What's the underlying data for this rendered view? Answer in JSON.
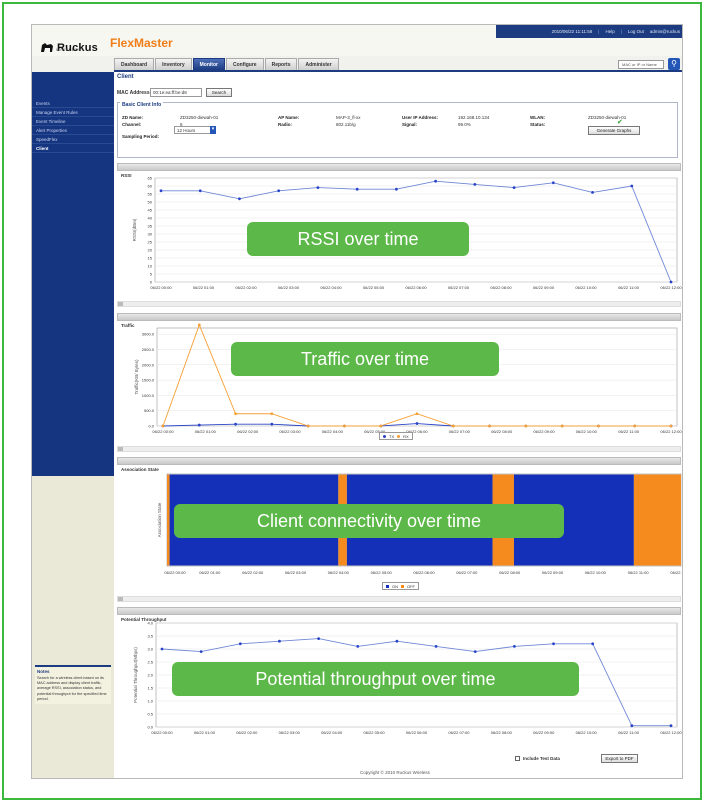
{
  "app": {
    "brand": "Ruckus",
    "brand_sub": "WIRELESS",
    "product": "FlexMaster",
    "util_datetime": "2010/06/22 11:11:58",
    "util_help": "Help",
    "util_logout": "Log Out",
    "util_user": "admin@ruckus"
  },
  "nav": {
    "tabs": [
      "Dashboard",
      "Inventory",
      "Monitor",
      "Configure",
      "Reports",
      "Administer"
    ],
    "active": "Monitor",
    "search_placeholder": "MAC or IP or Name"
  },
  "sidebar": {
    "items": [
      "Events",
      "Manage Event Rules",
      "Event Timeline",
      "Alert Properties",
      "SpeedFlex",
      "Client"
    ],
    "active": "Client",
    "notes_title": "Notes",
    "notes_text": "Search for a wireless client based on its MAC address and display client traffic, average RSSI, association status, and potential throughput for the specified time period."
  },
  "client": {
    "title": "Client",
    "mac_label": "MAC Address",
    "mac_value": "00:1e:ea:ff:be:d8",
    "search_label": "Search",
    "info_title": "Basic Client Info",
    "zd_label": "ZD Name:",
    "zd_value": "ZD3250-diewah-01",
    "channel_label": "Channel:",
    "channel_value": "6",
    "ap_label": "AP Name:",
    "ap_value": "MAP-3_fl-xx",
    "radio_label": "Radio:",
    "radio_value": "802.11b/g",
    "ip_label": "User IP Address:",
    "ip_value": "192.168.10.134",
    "signal_label": "Signal:",
    "signal_value": "99.0%",
    "wlan_label": "WLAN:",
    "wlan_value": "ZD3250-diewah-01",
    "status_label": "Status:",
    "sampling_label": "Sampling Period:",
    "sampling_value": "12 Hours",
    "generate_label": "Generate Graphs"
  },
  "sections": {
    "rssi": "RSSI",
    "traffic": "Traffic",
    "assoc": "Association State",
    "throughput": "Potential Throughput"
  },
  "callouts": {
    "rssi": "RSSI over time",
    "traffic": "Traffic over time",
    "assoc": "Client connectivity over time",
    "throughput": "Potential throughput over time"
  },
  "footer": {
    "include_label": "Include Test Data",
    "export_label": "Export to PDF",
    "copyright": "Copyright © 2010 Ruckus Wireless"
  },
  "colors": {
    "brand_blue": "#1c3b80",
    "accent_orange": "#f07d17",
    "series_blue": "#2a44c8",
    "series_orange": "#f5a035",
    "assoc_on": "#1530b8",
    "assoc_off": "#f58a1f",
    "callout_green": "#5cb848"
  },
  "chart_data": [
    {
      "type": "line",
      "ylabel": "RSSI(dBm)",
      "x": [
        "06/22 00:00",
        "06/22 01:00",
        "06/22 02:00",
        "06/22 03:00",
        "06/22 04:00",
        "06/22 05:00",
        "06/22 06:00",
        "06/22 07:00",
        "06/22 08:00",
        "06/22 09:00",
        "06/22 10:00",
        "06/22 11:00",
        "06/22 12:00"
      ],
      "y_ticks": [
        "0",
        "5",
        "10",
        "15",
        "20",
        "25",
        "30",
        "35",
        "40",
        "45",
        "50",
        "55",
        "60",
        "65"
      ],
      "ylim": [
        0,
        65
      ],
      "series": [
        {
          "name": "",
          "values": [
            57,
            57,
            52,
            57,
            59,
            58,
            58,
            63,
            61,
            59,
            62,
            56,
            60,
            0
          ]
        }
      ]
    },
    {
      "type": "line",
      "ylabel": "Traffic(KB/ Bytes)",
      "x": [
        "06/22 00:00",
        "06/22 01:00",
        "06/22 02:00",
        "06/22 03:00",
        "06/22 04:00",
        "06/22 05:00",
        "06/22 06:00",
        "06/22 07:00",
        "06/22 08:00",
        "06/22 09:00",
        "06/22 10:00",
        "06/22 11:00",
        "06/22 12:00"
      ],
      "y_ticks": [
        "0.0",
        "500.0",
        "1000.0",
        "1500.0",
        "2000.0",
        "2500.0",
        "3000.0"
      ],
      "ylim": [
        0,
        3200
      ],
      "series": [
        {
          "name": "TX",
          "values": [
            0,
            30,
            60,
            60,
            0,
            0,
            0,
            80,
            0,
            0,
            0,
            0,
            0,
            0,
            0
          ]
        },
        {
          "name": "RX",
          "values": [
            0,
            3300,
            400,
            400,
            0,
            0,
            0,
            400,
            0,
            0,
            0,
            0,
            0,
            0,
            0
          ]
        }
      ]
    },
    {
      "type": "area",
      "ylabel": "Association State",
      "x": [
        "06/22 00:00",
        "06/22 01:00",
        "06/22 02:00",
        "06/22 03:00",
        "06/22 04:00",
        "06/22 05:00",
        "06/22 06:00",
        "06/22 07:00",
        "06/22 08:00",
        "06/22 09:00",
        "06/22 10:00",
        "06/22 11:00",
        "06/22 12:00"
      ],
      "legend": [
        "ON",
        "OFF"
      ],
      "segments": [
        {
          "state": "OFF",
          "start": 0,
          "end": 0.06
        },
        {
          "state": "ON",
          "start": 0.06,
          "end": 4.0
        },
        {
          "state": "OFF",
          "start": 4.0,
          "end": 4.2
        },
        {
          "state": "ON",
          "start": 4.2,
          "end": 7.6
        },
        {
          "state": "OFF",
          "start": 7.6,
          "end": 8.1
        },
        {
          "state": "ON",
          "start": 8.1,
          "end": 10.9
        },
        {
          "state": "OFF",
          "start": 10.9,
          "end": 12.0
        }
      ]
    },
    {
      "type": "line",
      "ylabel": "Potential Throughput(Mbps)",
      "x": [
        "06/22 00:00",
        "06/22 01:00",
        "06/22 02:00",
        "06/22 03:00",
        "06/22 04:00",
        "06/22 05:00",
        "06/22 06:00",
        "06/22 07:00",
        "06/22 08:00",
        "06/22 09:00",
        "06/22 10:00",
        "06/22 11:00",
        "06/22 12:00"
      ],
      "y_ticks": [
        "0.0",
        "0.5",
        "1.0",
        "1.5",
        "2.0",
        "2.5",
        "3.0",
        "3.5",
        "4.0"
      ],
      "ylim": [
        0,
        4.0
      ],
      "series": [
        {
          "name": "",
          "values": [
            3.0,
            2.9,
            3.2,
            3.3,
            3.4,
            3.1,
            3.3,
            3.1,
            2.9,
            3.1,
            3.2,
            3.2,
            0.05,
            0.05
          ]
        }
      ]
    }
  ]
}
